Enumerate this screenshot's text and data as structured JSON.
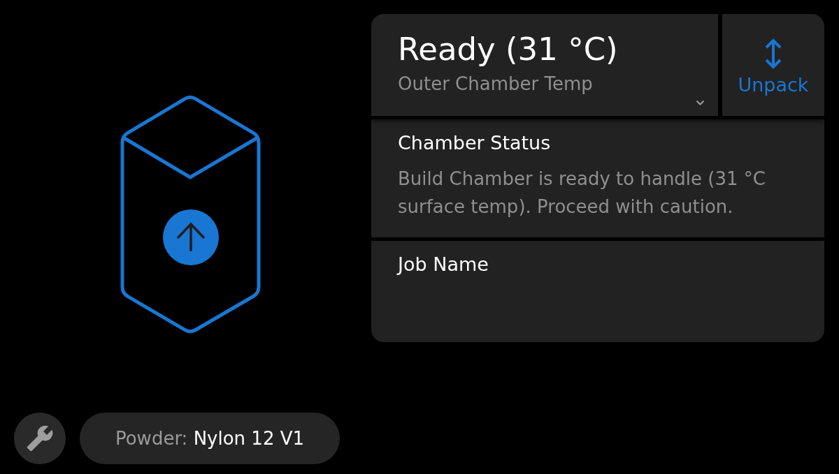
{
  "status_card": {
    "title": "Ready (31 °C)",
    "subtitle": "Outer Chamber Temp"
  },
  "unpack_button": {
    "label": "Unpack"
  },
  "sections": [
    {
      "title": "Chamber Status",
      "body": "Build Chamber is ready to handle (31 °C surface temp). Proceed with caution."
    },
    {
      "title": "Job Name"
    }
  ],
  "powder": {
    "label": "Powder:",
    "value": "Nylon 12 V1"
  }
}
